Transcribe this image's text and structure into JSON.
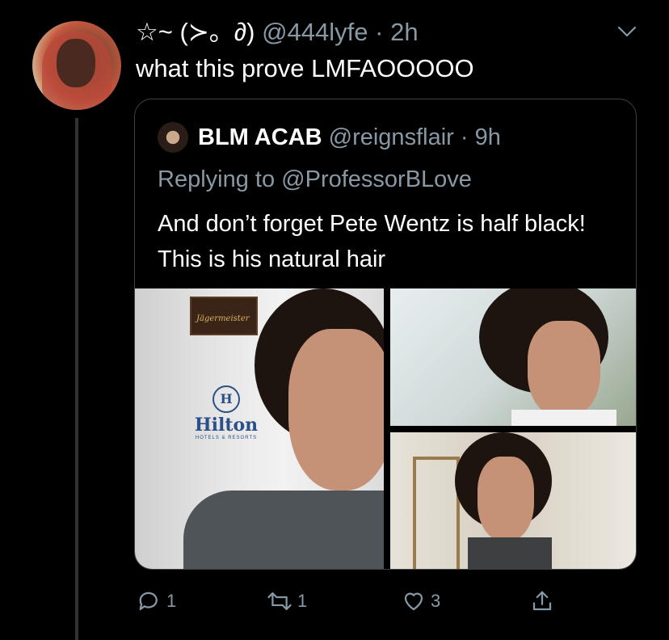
{
  "tweet": {
    "display_name": "☆~ (ㆀ́ 。 ̀ㆀ)",
    "display_name_text": "☆~ (≻。∂)",
    "handle": "@444lyfe",
    "separator": " · ",
    "time": "2h",
    "text": "what this prove LMFAOOOOO",
    "avatar_icon": "profile-avatar"
  },
  "quoted": {
    "display_name": "BLM ACAB",
    "handle": "@reignsflair",
    "separator": " · ",
    "time": "9h",
    "replying_prefix": "Replying to ",
    "replying_to": "@ProfessorBLove",
    "text": "And don’t forget Pete Wentz is half black! This is his natural hair",
    "images": [
      {
        "logo_text": "Jägermeister",
        "sign_word": "Hilton",
        "sign_sub": "HOTELS & RESORTS",
        "sign_mark": "H"
      },
      {},
      {}
    ]
  },
  "actions": {
    "reply_count": "1",
    "retweet_count": "1",
    "like_count": "3",
    "share_label": ""
  },
  "colors": {
    "background": "#000000",
    "secondary_text": "#8899a6",
    "border": "#3d4247"
  }
}
